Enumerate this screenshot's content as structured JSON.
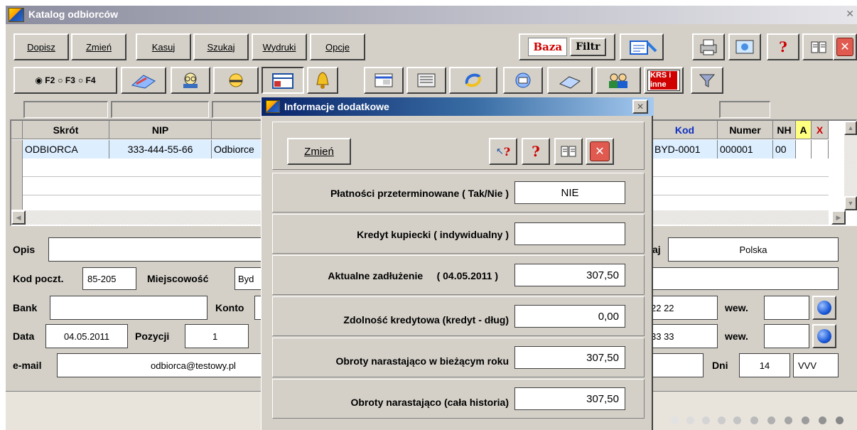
{
  "window": {
    "title": "Katalog odbiorców"
  },
  "menu": [
    "Dopisz",
    "Zmień",
    "Kasuj",
    "Szukaj",
    "Wydruki",
    "Opcje"
  ],
  "toolbar": {
    "baza_label": "Baza",
    "filtr_label": "Filtr",
    "krs_label": "KRS i inne"
  },
  "fkeys": [
    "F2",
    "F3",
    "F4"
  ],
  "grid": {
    "headers": [
      "Skrót",
      "NIP",
      "Kod",
      "Numer",
      "NH",
      "A",
      "X"
    ],
    "row": {
      "skrot": "ODBIORCA",
      "nip": "333-444-55-66",
      "nazwa": "Odbiorce",
      "kod": "BYD-0001",
      "numer": "000001",
      "nh": "00"
    }
  },
  "form": {
    "opis_label": "Opis",
    "kraj_label_partial": "aj",
    "kraj_value": "Polska",
    "kod_poczt_label": "Kod poczt.",
    "kod_poczt_value": "85-205",
    "miejscowosc_label": "Miejscowość",
    "miejscowosc_value": "Byd",
    "bank_label": "Bank",
    "konto_label": "Konto",
    "tel1_partial": "22 22",
    "wew1_label": "wew.",
    "data_label": "Data",
    "data_value": "04.05.2011",
    "pozycji_label": "Pozycji",
    "pozycji_value": "1",
    "tel2_partial": "33 33",
    "wew2_label": "wew.",
    "email_label": "e-mail",
    "email_value": "odbiorca@testowy.pl",
    "dni_label": "Dni",
    "dni_value": "14",
    "vvv_value": "VVV"
  },
  "dialog": {
    "title": "Informacje dodatkowe",
    "edit_label": "Zmień",
    "rows": [
      {
        "label": "Płatności przeterminowane ( Tak/Nie )",
        "value": "NIE"
      },
      {
        "label": "Kredyt kupiecki ( indywidualny )",
        "value": ""
      },
      {
        "label": "Aktualne zadłużenie     ( 04.05.2011 )",
        "value": "307,50"
      },
      {
        "label": "Zdolność kredytowa (kredyt - dług)",
        "value": "0,00"
      },
      {
        "label": "Obroty narastająco w bieżącym roku",
        "value": "307,50"
      },
      {
        "label": "Obroty narastająco (cała historia)",
        "value": "307,50"
      }
    ]
  },
  "colors": {
    "accent_blue": "#0a246a",
    "close_red": "#e05a50",
    "window_bg": "#d4d0c8"
  }
}
